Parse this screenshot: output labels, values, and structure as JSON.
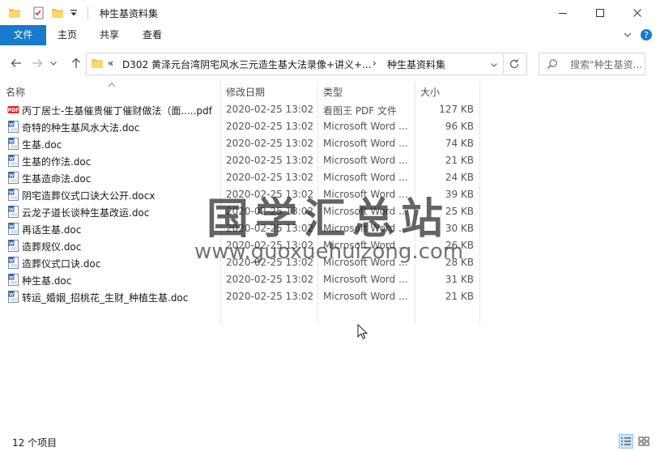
{
  "window": {
    "title": "种生基资料集",
    "minimize_glyph": "–",
    "maximize_glyph": "□",
    "close_glyph": "✕"
  },
  "ribbon": {
    "tabs": [
      "文件",
      "主页",
      "共享",
      "查看"
    ]
  },
  "address": {
    "overflow": "«",
    "path_parent": "D302 黄泽元台湾阴宅风水三元造生基大法录像+讲义+...",
    "separator": "›",
    "path_current": "种生基资料集"
  },
  "search": {
    "placeholder": "搜索\"种生基资..."
  },
  "columns": {
    "name": "名称",
    "date": "修改日期",
    "type": "类型",
    "size": "大小"
  },
  "files": [
    {
      "name": "丙丁居士-生基催贵催丁催财做法（面.....pdf",
      "date": "2020-02-25 13:02",
      "type": "看图王 PDF 文件",
      "size": "127 KB",
      "icon": "pdf-file-icon"
    },
    {
      "name": "奇特的种生基风水大法.doc",
      "date": "2020-02-25 13:02",
      "type": "Microsoft Word ...",
      "size": "96 KB",
      "icon": "word-file-icon"
    },
    {
      "name": "生基.doc",
      "date": "2020-02-25 13:02",
      "type": "Microsoft Word ...",
      "size": "74 KB",
      "icon": "word-file-icon"
    },
    {
      "name": "生基的作法.doc",
      "date": "2020-02-25 13:02",
      "type": "Microsoft Word ...",
      "size": "21 KB",
      "icon": "word-file-icon"
    },
    {
      "name": "生基造命法.doc",
      "date": "2020-02-25 13:02",
      "type": "Microsoft Word ...",
      "size": "24 KB",
      "icon": "word-file-icon"
    },
    {
      "name": "阴宅造葬仪式口诀大公开.docx",
      "date": "2020-02-25 13:02",
      "type": "Microsoft Word ...",
      "size": "39 KB",
      "icon": "word-file-icon"
    },
    {
      "name": "云龙子道长谈种生基改运.doc",
      "date": "2020-02-25 13:02",
      "type": "Microsoft Word ...",
      "size": "25 KB",
      "icon": "word-file-icon"
    },
    {
      "name": "再话生基.doc",
      "date": "2020-02-25 13:02",
      "type": "Microsoft Word ...",
      "size": "30 KB",
      "icon": "word-file-icon"
    },
    {
      "name": "造葬规仪.doc",
      "date": "2020-02-25 13:02",
      "type": "Microsoft Word ...",
      "size": "26 KB",
      "icon": "word-file-icon"
    },
    {
      "name": "造葬仪式口诀.doc",
      "date": "2020-02-25 13:02",
      "type": "Microsoft Word ...",
      "size": "28 KB",
      "icon": "word-file-icon"
    },
    {
      "name": "种生基.doc",
      "date": "2020-02-25 13:02",
      "type": "Microsoft Word ...",
      "size": "31 KB",
      "icon": "word-file-icon"
    },
    {
      "name": "转运_婚姻_招桃花_生财_种植生基.doc",
      "date": "2020-02-25 13:02",
      "type": "Microsoft Word ...",
      "size": "21 KB",
      "icon": "word-file-icon"
    }
  ],
  "watermark": {
    "text_cn": "国学汇总站",
    "text_url": "www.guoxuehuizong.com"
  },
  "status": {
    "item_count": "12 个项目"
  },
  "colors": {
    "accent": "#1979ca",
    "folder": "#f4c444",
    "pdf_red": "#d8302f",
    "word_blue": "#2b5797"
  }
}
